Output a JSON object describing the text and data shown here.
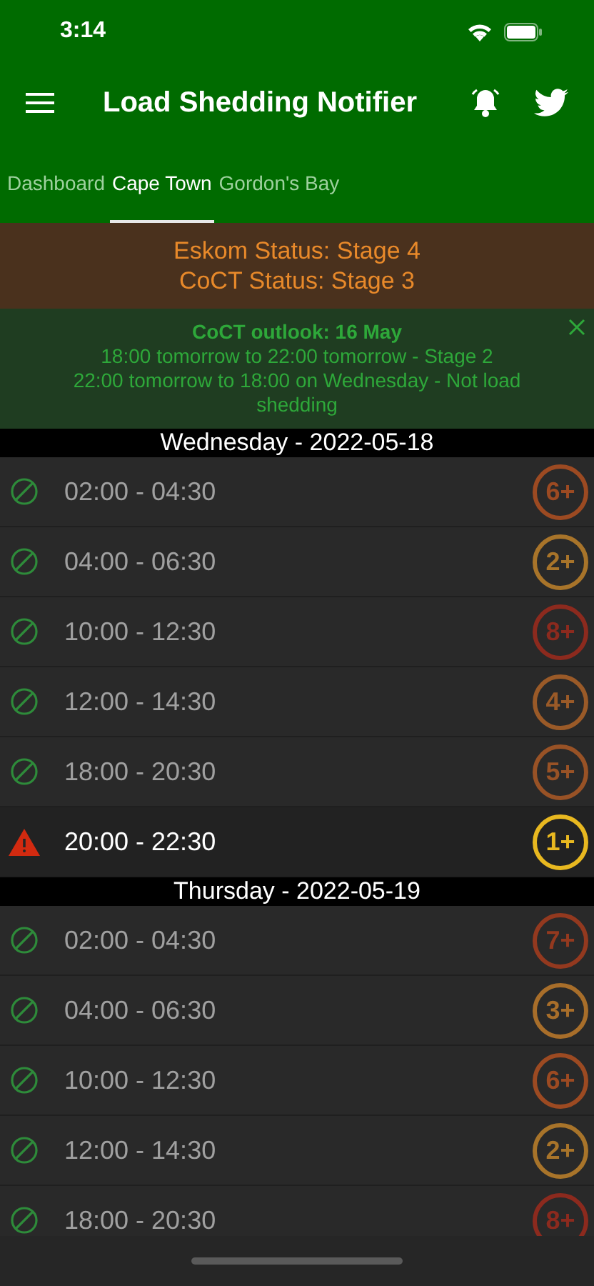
{
  "status_bar": {
    "time": "3:14"
  },
  "header": {
    "title": "Load Shedding Notifier"
  },
  "tabs": [
    {
      "label": "Dashboard",
      "selected": false
    },
    {
      "label": "Cape Town",
      "selected": true
    },
    {
      "label": "Gordon's Bay",
      "selected": false
    }
  ],
  "status": [
    "Eskom Status: Stage 4",
    "CoCT Status: Stage 3"
  ],
  "outlook": {
    "title": "CoCT outlook: 16 May",
    "lines": [
      "18:00 tomorrow to 22:00 tomorrow - Stage 2",
      "22:00 tomorrow to 18:00 on Wednesday - Not load shedding"
    ]
  },
  "days": [
    {
      "title": "Wednesday - 2022-05-18",
      "slots": [
        {
          "kind": "clear",
          "time": "02:00 - 04:30",
          "stage": "6+",
          "color": "#9c4a22"
        },
        {
          "kind": "clear",
          "time": "04:00 - 06:30",
          "stage": "2+",
          "color": "#a8742a"
        },
        {
          "kind": "clear",
          "time": "10:00 - 12:30",
          "stage": "8+",
          "color": "#8c2a1e"
        },
        {
          "kind": "clear",
          "time": "12:00 - 14:30",
          "stage": "4+",
          "color": "#9a5a28"
        },
        {
          "kind": "clear",
          "time": "18:00 - 20:30",
          "stage": "5+",
          "color": "#985226"
        },
        {
          "kind": "alert",
          "time": "20:00 - 22:30",
          "stage": "1+",
          "color": "#e8b820"
        }
      ]
    },
    {
      "title": "Thursday - 2022-05-19",
      "slots": [
        {
          "kind": "clear",
          "time": "02:00 - 04:30",
          "stage": "7+",
          "color": "#93391f"
        },
        {
          "kind": "clear",
          "time": "04:00 - 06:30",
          "stage": "3+",
          "color": "#a86e2a"
        },
        {
          "kind": "clear",
          "time": "10:00 - 12:30",
          "stage": "6+",
          "color": "#9c4a22"
        },
        {
          "kind": "clear",
          "time": "12:00 - 14:30",
          "stage": "2+",
          "color": "#a8742a"
        },
        {
          "kind": "clear",
          "time": "18:00 - 20:30",
          "stage": "8+",
          "color": "#8c2a1e"
        }
      ]
    }
  ]
}
